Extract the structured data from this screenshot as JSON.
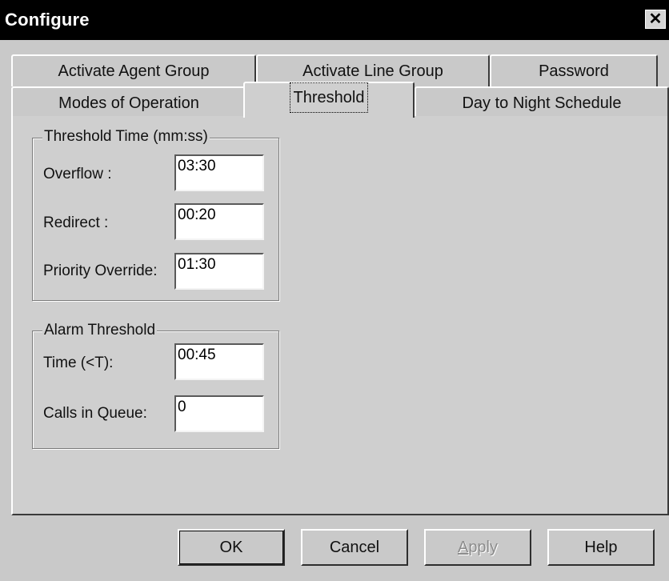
{
  "window": {
    "title": "Configure",
    "close_glyph": "✕"
  },
  "tabs": {
    "row1": [
      "Activate Agent Group",
      "Activate Line Group",
      "Password"
    ],
    "row2": [
      "Modes of Operation",
      "Threshold",
      "Day to Night Schedule"
    ],
    "active": "Threshold"
  },
  "threshold_time": {
    "legend": "Threshold Time (mm:ss)",
    "overflow_label": "Overflow :",
    "overflow_value": "03:30",
    "redirect_label": "Redirect :",
    "redirect_value": "00:20",
    "priority_label": "Priority Override:",
    "priority_value": "01:30"
  },
  "alarm_threshold": {
    "legend": "Alarm Threshold",
    "time_label": "Time (<T):",
    "time_value": "00:45",
    "calls_label": "Calls in Queue:",
    "calls_value": "0"
  },
  "buttons": {
    "ok": "OK",
    "cancel": "Cancel",
    "apply_first": "A",
    "apply_rest": "pply",
    "help": "Help"
  }
}
